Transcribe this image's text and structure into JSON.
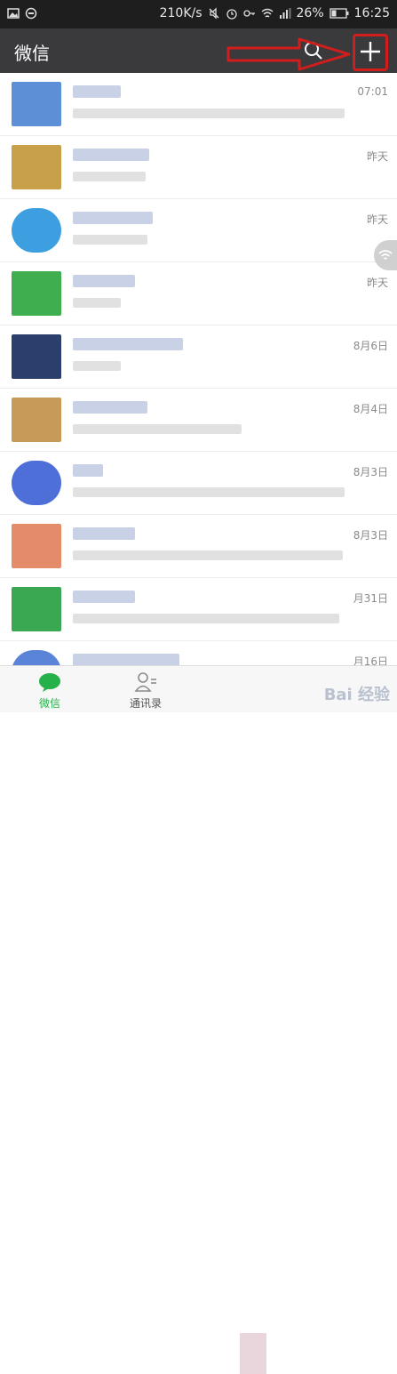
{
  "status_bar": {
    "speed": "210K/s",
    "battery_pct": "26%",
    "clock": "16:25"
  },
  "header": {
    "title": "微信"
  },
  "chats": [
    {
      "time": "07:01",
      "avatar_color": "#5d8fd6"
    },
    {
      "time": "昨天",
      "avatar_color": "#c9a04a"
    },
    {
      "time": "昨天",
      "avatar_color": "#3d9fe0"
    },
    {
      "time": "昨天",
      "avatar_color": "#3fae4f"
    },
    {
      "time": "8月6日",
      "avatar_color": "#2a3f6b"
    },
    {
      "time": "8月4日",
      "avatar_color": "#c79a58"
    },
    {
      "time": "8月3日",
      "avatar_color": "#4e6fd8"
    },
    {
      "time": "8月3日",
      "avatar_color": "#e48b6a"
    },
    {
      "time": "月31日",
      "avatar_color": "#3aa852"
    },
    {
      "time": "月16日",
      "avatar_color": "#5a84d8"
    }
  ],
  "tabs": [
    {
      "label": "微信",
      "active": true
    },
    {
      "label": "通讯录",
      "active": false
    }
  ],
  "watermark": "Bai 经验",
  "colors": {
    "active_tab": "#27b14b",
    "annotation_red": "#d21d1d"
  }
}
